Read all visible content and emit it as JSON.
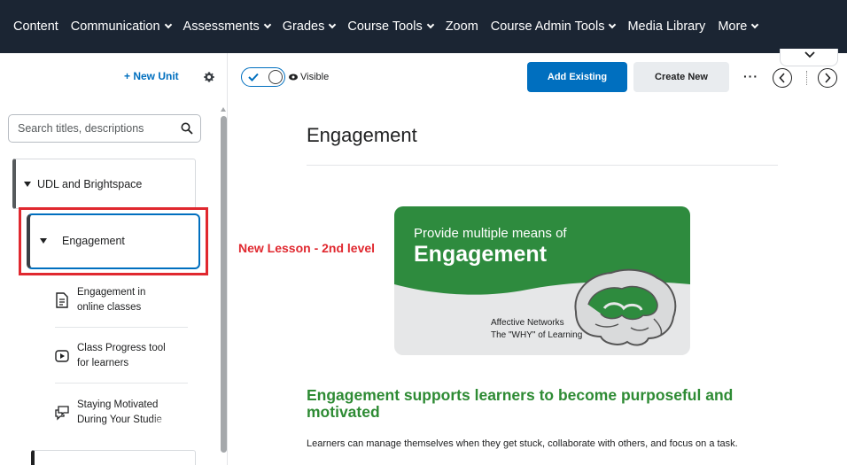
{
  "navbar": {
    "items": [
      {
        "label": "Content",
        "dropdown": false
      },
      {
        "label": "Communication",
        "dropdown": true
      },
      {
        "label": "Assessments",
        "dropdown": true
      },
      {
        "label": "Grades",
        "dropdown": true
      },
      {
        "label": "Course Tools",
        "dropdown": true
      },
      {
        "label": "Zoom",
        "dropdown": false
      },
      {
        "label": "Course Admin Tools",
        "dropdown": true
      },
      {
        "label": "Media Library",
        "dropdown": false
      },
      {
        "label": "More",
        "dropdown": true
      }
    ],
    "background": "#1b2533"
  },
  "toolbar": {
    "new_unit_label": "+ New Unit",
    "visibility_label": "Visible",
    "visibility_on": true,
    "add_existing_label": "Add Existing",
    "create_new_label": "Create New",
    "more_label": "···",
    "accent": "#006fbf"
  },
  "sidebar": {
    "search_placeholder": "Search titles, descriptions",
    "unit": {
      "title": "UDL and Brightspace",
      "expanded": true
    },
    "lesson": {
      "title": "Engagement",
      "expanded": true,
      "selected": true
    },
    "topics": [
      {
        "line1": "Engagement in",
        "line2": "online classes",
        "icon": "document-icon"
      },
      {
        "line1": "Class Progress tool",
        "line2": "for learners",
        "icon": "video-icon"
      },
      {
        "line1": "Staying Motivated",
        "line2": "During Your Studie",
        "icon": "discussion-icon"
      }
    ]
  },
  "annotation": {
    "text": "New Lesson - 2nd level",
    "color": "#e0282f"
  },
  "main": {
    "title": "Engagement",
    "banner": {
      "small_text": "Provide multiple means of",
      "big_text": "Engagement",
      "line1": "Affective Networks",
      "line2": "The \"WHY\" of Learning",
      "green": "#2e8b3e"
    },
    "heading": "Engagement supports learners to become purposeful and motivated",
    "heading_color": "#2e8b34",
    "body": "Learners can manage themselves when they get stuck, collaborate with others, and focus on a task."
  }
}
